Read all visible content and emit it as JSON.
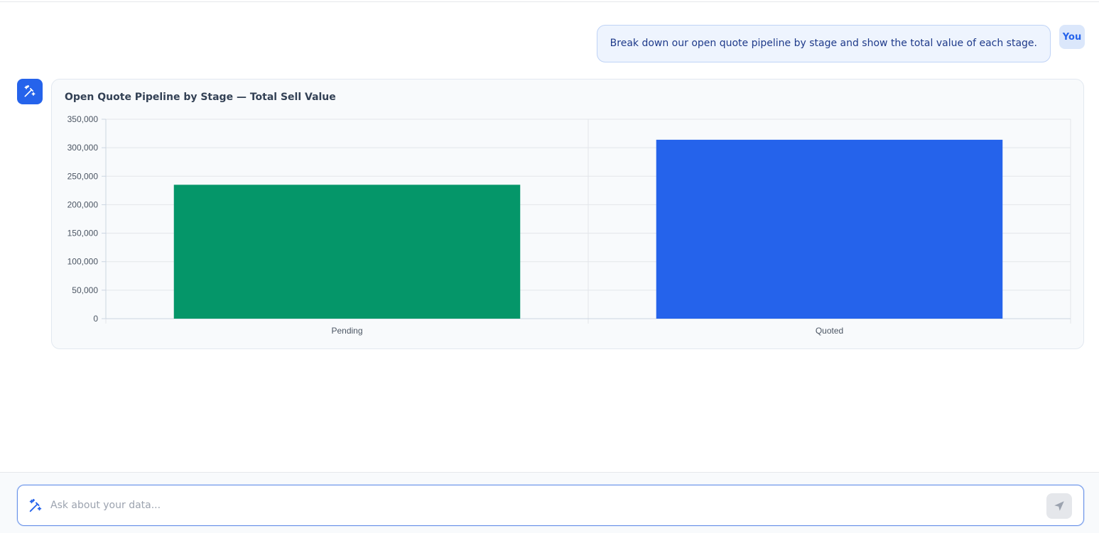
{
  "conversation": {
    "user_message": "Break down our open quote pipeline by stage and show the total value of each stage.",
    "user_label": "You"
  },
  "chart_card": {
    "title": "Open Quote Pipeline by Stage — Total Sell Value"
  },
  "chart_data": {
    "type": "bar",
    "title": "Open Quote Pipeline by Stage — Total Sell Value",
    "categories": [
      "Pending",
      "Quoted"
    ],
    "values": [
      235000,
      314000
    ],
    "colors": [
      "#059669",
      "#2563eb"
    ],
    "ylim": [
      0,
      350000
    ],
    "yticks": [
      0,
      50000,
      100000,
      150000,
      200000,
      250000,
      300000,
      350000
    ],
    "ytick_labels": [
      "0",
      "50,000",
      "100,000",
      "150,000",
      "200,000",
      "250,000",
      "300,000",
      "350,000"
    ],
    "grid": true,
    "xlabel": "",
    "ylabel": ""
  },
  "composer": {
    "placeholder": "Ask about your data...",
    "value": ""
  },
  "icons": {
    "assistant": "magic-wand-icon",
    "composer": "magic-wand-icon",
    "send": "send-icon"
  },
  "colors": {
    "accent": "#2563eb",
    "pending_bar": "#059669",
    "quoted_bar": "#2563eb"
  }
}
